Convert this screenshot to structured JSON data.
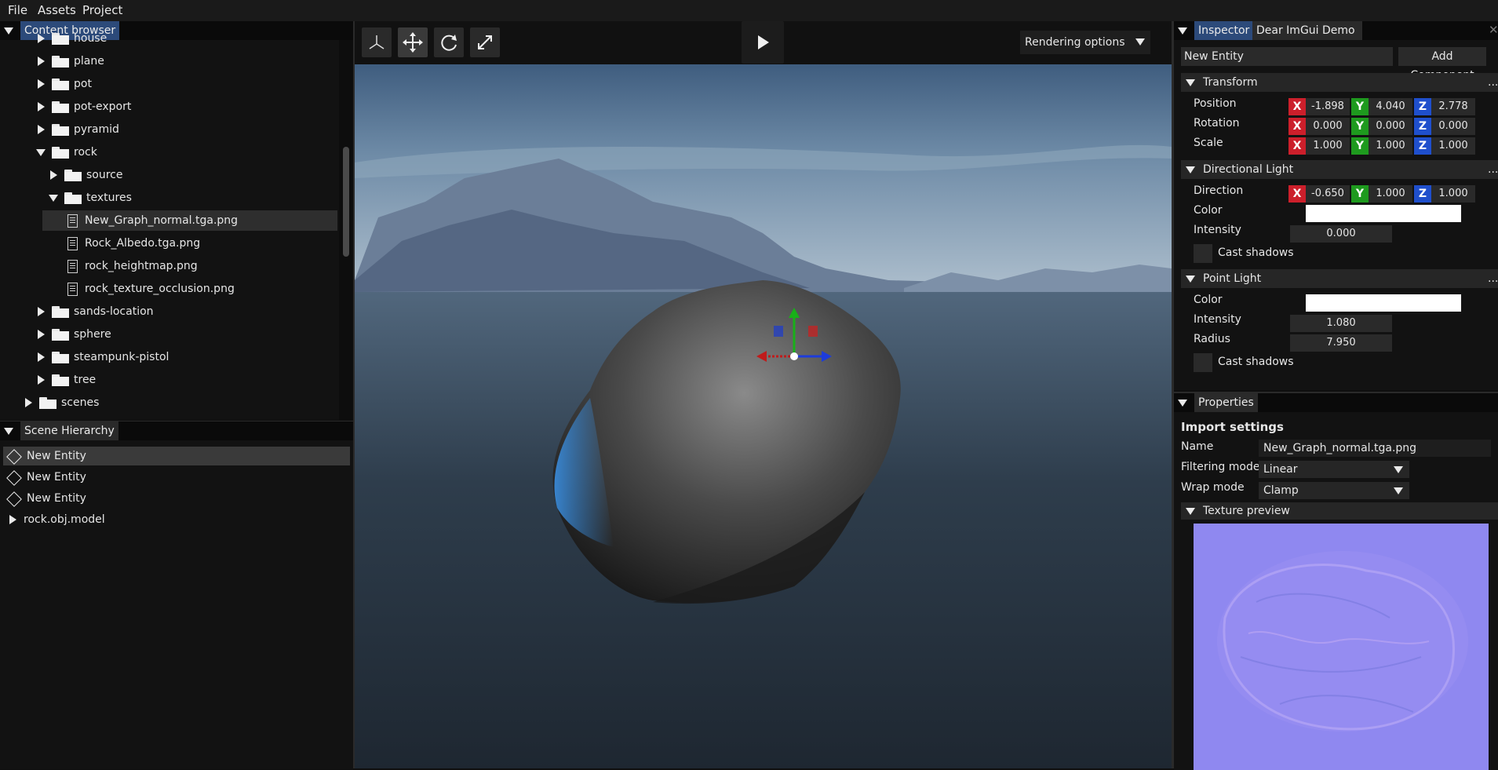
{
  "menu": {
    "file": "File",
    "assets": "Assets",
    "project": "Project"
  },
  "content_browser": {
    "title": "Content browser",
    "items": [
      {
        "label": "house",
        "type": "folder",
        "depth": 1,
        "state": "collapsed"
      },
      {
        "label": "plane",
        "type": "folder",
        "depth": 1,
        "state": "collapsed"
      },
      {
        "label": "pot",
        "type": "folder",
        "depth": 1,
        "state": "collapsed"
      },
      {
        "label": "pot-export",
        "type": "folder",
        "depth": 1,
        "state": "collapsed"
      },
      {
        "label": "pyramid",
        "type": "folder",
        "depth": 1,
        "state": "collapsed"
      },
      {
        "label": "rock",
        "type": "folder",
        "depth": 1,
        "state": "expanded"
      },
      {
        "label": "source",
        "type": "folder",
        "depth": 2,
        "state": "collapsed"
      },
      {
        "label": "textures",
        "type": "folder",
        "depth": 2,
        "state": "expanded"
      },
      {
        "label": "New_Graph_normal.tga.png",
        "type": "file",
        "depth": 3,
        "selected": true
      },
      {
        "label": "Rock_Albedo.tga.png",
        "type": "file",
        "depth": 3
      },
      {
        "label": "rock_heightmap.png",
        "type": "file",
        "depth": 3
      },
      {
        "label": "rock_texture_occlusion.png",
        "type": "file",
        "depth": 3
      },
      {
        "label": "sands-location",
        "type": "folder",
        "depth": 1,
        "state": "collapsed"
      },
      {
        "label": "sphere",
        "type": "folder",
        "depth": 1,
        "state": "collapsed"
      },
      {
        "label": "steampunk-pistol",
        "type": "folder",
        "depth": 1,
        "state": "collapsed"
      },
      {
        "label": "tree",
        "type": "folder",
        "depth": 1,
        "state": "collapsed"
      },
      {
        "label": "scenes",
        "type": "folder",
        "depth": 0,
        "state": "collapsed"
      }
    ]
  },
  "scene_hierarchy": {
    "title": "Scene Hierarchy",
    "entities": [
      {
        "label": "New Entity",
        "selected": true
      },
      {
        "label": "New Entity"
      },
      {
        "label": "New Entity"
      }
    ],
    "model": "rock.obj.model"
  },
  "viewport": {
    "tools": [
      "axes-tool-icon",
      "move-tool-icon",
      "rotate-tool-icon",
      "scale-tool-icon"
    ],
    "play_icon": "play-icon",
    "rendering_options": "Rendering options"
  },
  "inspector": {
    "tabs": {
      "inspector": "Inspector",
      "demo": "Dear ImGui Demo"
    },
    "entity_name": "New Entity",
    "add_component": "Add Component",
    "transform": {
      "title": "Transform",
      "more": "...",
      "position_label": "Position",
      "rotation_label": "Rotation",
      "scale_label": "Scale",
      "position": [
        "-1.898",
        "4.040",
        "2.778"
      ],
      "rotation": [
        "0.000",
        "0.000",
        "0.000"
      ],
      "scale": [
        "1.000",
        "1.000",
        "1.000"
      ]
    },
    "axis_labels": {
      "x": "X",
      "y": "Y",
      "z": "Z"
    },
    "directional_light": {
      "title": "Directional Light",
      "more": "...",
      "direction_label": "Direction",
      "direction": [
        "-0.650",
        "1.000",
        "1.000"
      ],
      "color_label": "Color",
      "color": "#ffffff",
      "intensity_label": "Intensity",
      "intensity": "0.000",
      "cast_shadows": "Cast shadows"
    },
    "point_light": {
      "title": "Point Light",
      "more": "...",
      "color_label": "Color",
      "color": "#ffffff",
      "intensity_label": "Intensity",
      "intensity": "1.080",
      "radius_label": "Radius",
      "radius": "7.950",
      "cast_shadows": "Cast shadows"
    }
  },
  "properties": {
    "tab": "Properties",
    "heading": "Import settings",
    "name_label": "Name",
    "name_value": "New_Graph_normal.tga.png",
    "filtering_label": "Filtering mode",
    "filtering_value": "Linear",
    "wrap_label": "Wrap mode",
    "wrap_value": "Clamp",
    "texture_preview": "Texture preview"
  },
  "colors": {
    "accent_tab": "#2c4a7a",
    "axis_x": "#cc1f2b",
    "axis_y": "#1e9a1e",
    "axis_z": "#1f4fcc",
    "normal_map": "#8f86f0"
  }
}
